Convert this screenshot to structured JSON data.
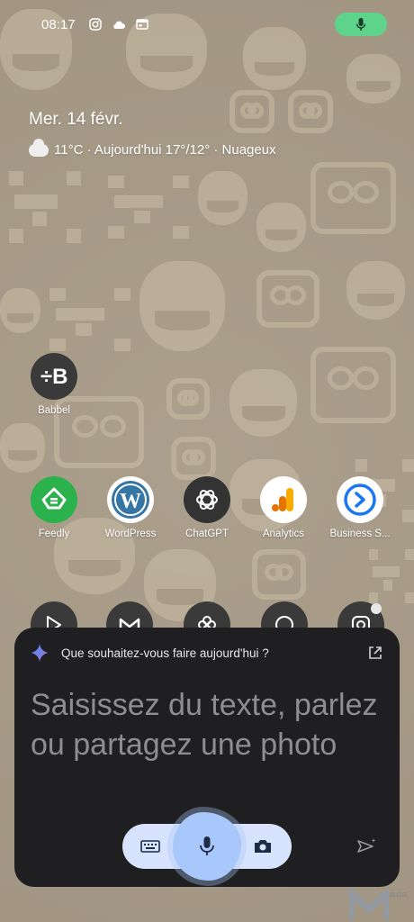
{
  "status_bar": {
    "time": "08:17",
    "icons": [
      "instagram-icon",
      "cloud-icon",
      "calendar-window-icon"
    ],
    "mic_indicator_color": "#5dd48a"
  },
  "widget": {
    "date": "Mer. 14 févr.",
    "weather_icon": "cloud-moon-icon",
    "weather_text": "11°C · Aujourd'hui 17°/12° · Nuageux"
  },
  "apps": [
    {
      "label": "Babbel",
      "icon": "babbel-icon",
      "color": "#3a3a3a"
    },
    {
      "label": "Feedly",
      "icon": "feedly-icon",
      "color": "#2bb24c"
    },
    {
      "label": "WordPress",
      "icon": "wordpress-icon",
      "color": "#ffffff"
    },
    {
      "label": "ChatGPT",
      "icon": "chatgpt-icon",
      "color": "#333333"
    },
    {
      "label": "Analytics",
      "icon": "analytics-icon",
      "color": "#ffffff"
    },
    {
      "label": "Business S...",
      "icon": "business-suite-icon",
      "color": "#ffffff"
    }
  ],
  "dock": [
    "play-store-icon",
    "gmail-icon",
    "pinwheel-icon",
    "whatsapp-icon",
    "instagram-icon"
  ],
  "assistant": {
    "question": "Que souhaitez-vous faire aujourd'hui ?",
    "prompt": "Saisissez du texte, parlez ou partagez une photo",
    "accent": "#a8c7fa",
    "bar_color": "#d7e3fc"
  },
  "watermark": {
    "text": "BLOG"
  }
}
